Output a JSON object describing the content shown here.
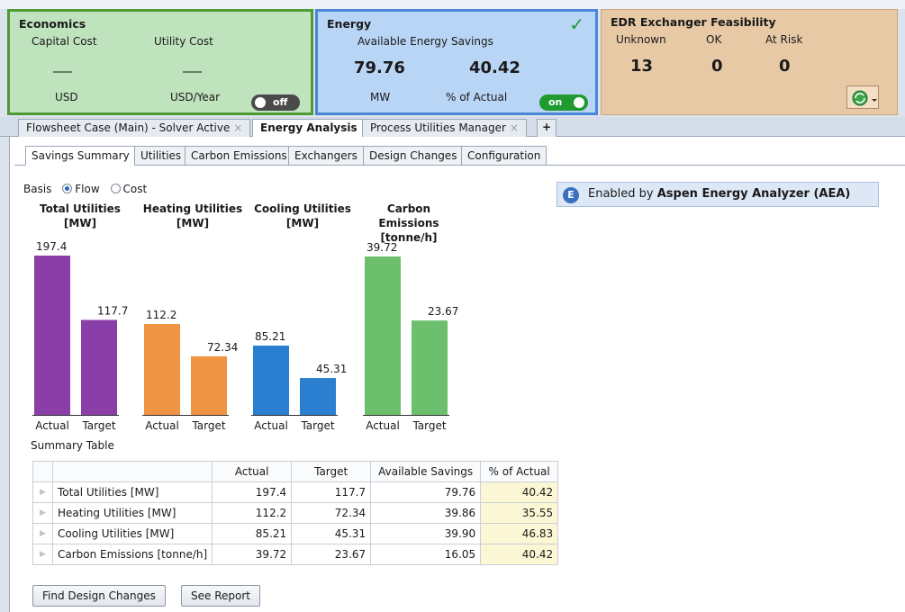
{
  "economics": {
    "title": "Economics",
    "capital_cost_label": "Capital Cost",
    "utility_cost_label": "Utility Cost",
    "capital_cost_value": "___",
    "utility_cost_value": "___",
    "capital_unit": "USD",
    "utility_unit": "USD/Year",
    "toggle_label": "off"
  },
  "energy": {
    "title": "Energy",
    "subtitle": "Available Energy Savings",
    "savings_value": "79.76",
    "pct_value": "40.42",
    "savings_unit": "MW",
    "pct_unit": "% of Actual",
    "toggle_label": "on",
    "check_icon": "✓"
  },
  "edr": {
    "title": "EDR Exchanger Feasibility",
    "labels": [
      "Unknown",
      "OK",
      "At Risk"
    ],
    "values": [
      "13",
      "0",
      "0"
    ]
  },
  "doc_tabs": [
    {
      "label": "Flowsheet Case (Main) - Solver Active",
      "active": false
    },
    {
      "label": "Energy Analysis",
      "active": true
    },
    {
      "label": "Process Utilities Manager",
      "active": false
    }
  ],
  "sub_tabs": [
    "Savings Summary",
    "Utilities",
    "Carbon Emissions",
    "Exchangers",
    "Design Changes",
    "Configuration"
  ],
  "basis": {
    "label": "Basis",
    "options": [
      "Flow",
      "Cost"
    ],
    "selected": "Flow"
  },
  "aea": {
    "prefix": "Enabled by ",
    "name": "Aspen Energy Analyzer (AEA)"
  },
  "chart_data": [
    {
      "type": "bar",
      "title": "Total Utilities [MW]",
      "title_lines": [
        "Total Utilities",
        "[MW]"
      ],
      "categories": [
        "Actual",
        "Target"
      ],
      "values": [
        197.4,
        117.7
      ],
      "labels": [
        "197.4",
        "117.7"
      ],
      "color": "#8a3fa8"
    },
    {
      "type": "bar",
      "title": "Heating Utilities [MW]",
      "title_lines": [
        "Heating Utilities",
        "[MW]"
      ],
      "categories": [
        "Actual",
        "Target"
      ],
      "values": [
        112.2,
        72.34
      ],
      "labels": [
        "112.2",
        "72.34"
      ],
      "color": "#ee9443"
    },
    {
      "type": "bar",
      "title": "Cooling Utilities [MW]",
      "title_lines": [
        "Cooling Utilities",
        "[MW]"
      ],
      "categories": [
        "Actual",
        "Target"
      ],
      "values": [
        85.21,
        45.31
      ],
      "labels": [
        "85.21",
        "45.31"
      ],
      "color": "#2a7fd0"
    },
    {
      "type": "bar",
      "title": "Carbon Emissions [tonne/h]",
      "title_lines": [
        "Carbon Emissions",
        "[tonne/h]"
      ],
      "categories": [
        "Actual",
        "Target"
      ],
      "values": [
        39.72,
        23.67
      ],
      "labels": [
        "39.72",
        "23.67"
      ],
      "color": "#6cbf6d"
    }
  ],
  "summary": {
    "title": "Summary Table",
    "headers": [
      "",
      "Actual",
      "Target",
      "Available Savings",
      "% of Actual"
    ],
    "rows": [
      {
        "name": "Total Utilities [MW]",
        "actual": "197.4",
        "target": "117.7",
        "savings": "79.76",
        "pct": "40.42"
      },
      {
        "name": "Heating Utilities [MW]",
        "actual": "112.2",
        "target": "72.34",
        "savings": "39.86",
        "pct": "35.55"
      },
      {
        "name": "Cooling Utilities [MW]",
        "actual": "85.21",
        "target": "45.31",
        "savings": "39.90",
        "pct": "46.83"
      },
      {
        "name": "Carbon Emissions [tonne/h]",
        "actual": "39.72",
        "target": "23.67",
        "savings": "16.05",
        "pct": "40.42"
      }
    ]
  },
  "buttons": {
    "find": "Find Design Changes",
    "report": "See Report"
  }
}
